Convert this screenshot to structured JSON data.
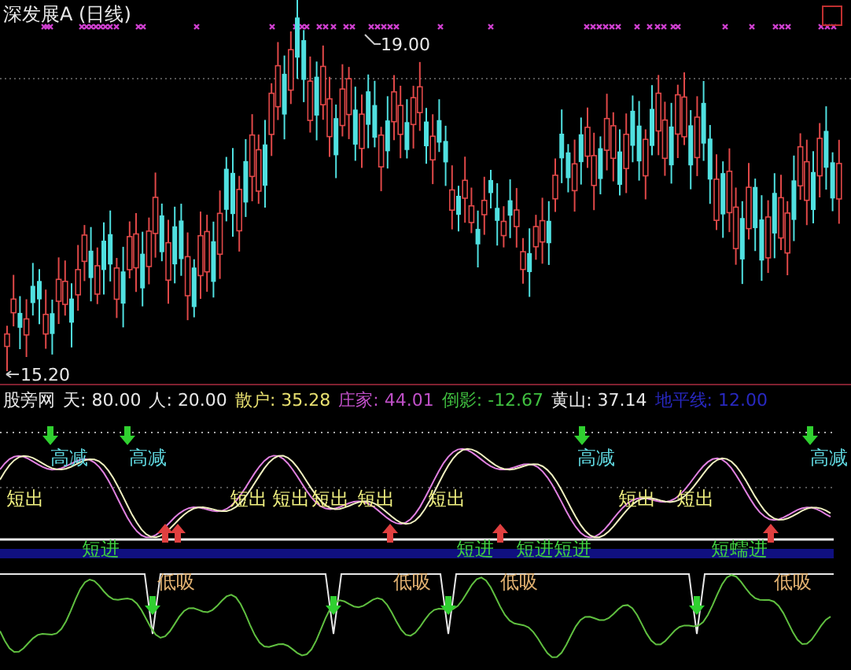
{
  "title": "深发展A (日线)",
  "price_marks": [
    {
      "label": "19.00",
      "kind": "high"
    },
    {
      "label": "15.20",
      "kind": "low"
    }
  ],
  "indicator": {
    "name": "股旁网",
    "values": [
      {
        "label": "天:",
        "value": "80.00",
        "color": "#e8e8e8"
      },
      {
        "label": "人:",
        "value": "20.00",
        "color": "#e8e8e8"
      },
      {
        "label": "散户:",
        "value": "35.28",
        "color": "#e8e070"
      },
      {
        "label": "庄家:",
        "value": "44.01",
        "color": "#c050c8"
      },
      {
        "label": "倒影:",
        "value": "-12.67",
        "color": "#40c040"
      },
      {
        "label": "黄山:",
        "value": "37.14",
        "color": "#e8e8e8"
      },
      {
        "label": "地平线:",
        "value": "12.00",
        "color": "#2828c0"
      }
    ]
  },
  "signals": [
    {
      "text": "高减",
      "kind": "reduce"
    },
    {
      "text": "高减",
      "kind": "reduce"
    },
    {
      "text": "高减",
      "kind": "reduce"
    },
    {
      "text": "高减",
      "kind": "reduce"
    },
    {
      "text": "短出",
      "kind": "sell"
    },
    {
      "text": "短出",
      "kind": "sell"
    },
    {
      "text": "短出",
      "kind": "sell"
    },
    {
      "text": "短出",
      "kind": "sell"
    },
    {
      "text": "短出",
      "kind": "sell"
    },
    {
      "text": "短出",
      "kind": "sell"
    },
    {
      "text": "短出",
      "kind": "sell"
    },
    {
      "text": "短出",
      "kind": "sell"
    },
    {
      "text": "短进",
      "kind": "buy"
    },
    {
      "text": "短进",
      "kind": "buy"
    },
    {
      "text": "短进短进",
      "kind": "buy"
    },
    {
      "text": "短蠕进",
      "kind": "buy"
    },
    {
      "text": "低吸",
      "kind": "dip"
    },
    {
      "text": "低吸",
      "kind": "dip"
    },
    {
      "text": "低吸",
      "kind": "dip"
    },
    {
      "text": "低吸",
      "kind": "dip"
    }
  ]
}
